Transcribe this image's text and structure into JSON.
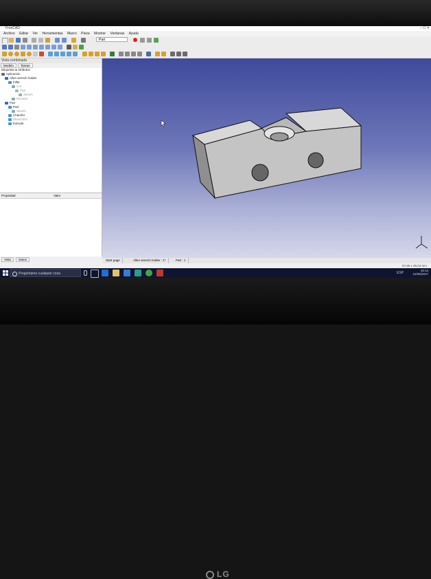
{
  "app": {
    "title": "FreeCAD",
    "window_controls": "–  ☐  ✕"
  },
  "menu": [
    "Archivo",
    "Editar",
    "Ver",
    "Herramientas",
    "Macro",
    "Pieza",
    "Mostrar",
    "Ventanas",
    "Ayuda"
  ],
  "toolbar": {
    "workbench": "Part"
  },
  "combo_view": {
    "title": "Vista combinada",
    "tabs": [
      "Modelo",
      "Tareas"
    ],
    "tree_header": "Etiquetas & Atributos",
    "tree": [
      {
        "label": "Aplicación",
        "level": 0,
        "muted": false
      },
      {
        "label": "Allen wrench holder",
        "level": 1,
        "muted": false
      },
      {
        "label": "Fillet",
        "level": 2,
        "muted": false
      },
      {
        "label": "Cut",
        "level": 3,
        "muted": true
      },
      {
        "label": "Pad",
        "level": 4,
        "muted": true
      },
      {
        "label": "Sketch",
        "level": 5,
        "muted": true
      },
      {
        "label": "Revolve",
        "level": 3,
        "muted": true
      },
      {
        "label": "Part",
        "level": 1,
        "muted": false
      },
      {
        "label": "Pad",
        "level": 2,
        "muted": false
      },
      {
        "label": "Sketch",
        "level": 3,
        "muted": true
      },
      {
        "label": "Chamfer",
        "level": 2,
        "muted": false
      },
      {
        "label": "Sketch001",
        "level": 2,
        "muted": true
      },
      {
        "label": "Extrude",
        "level": 2,
        "muted": false
      }
    ],
    "props_headers": [
      "Propiedad",
      "Valor"
    ],
    "bottom_tabs": [
      "Vista",
      "Datos"
    ]
  },
  "document_tabs": [
    "Start page",
    "Allen wrench holder : 1*",
    "Part : 1"
  ],
  "status": {
    "dimensions": "87,85 x 39,04 mm"
  },
  "taskbar": {
    "search_placeholder": "Pregúntame cualquier cosa",
    "tray_lang": "ESP",
    "time": "19:13",
    "date": "21/06/2017"
  },
  "monitor": {
    "brand": "LG"
  },
  "colors": {
    "viewport_top": "#3f4a9c",
    "viewport_bottom": "#d6d8ea",
    "taskbar": "#0e1530",
    "part_face": "#c4c4c4"
  }
}
